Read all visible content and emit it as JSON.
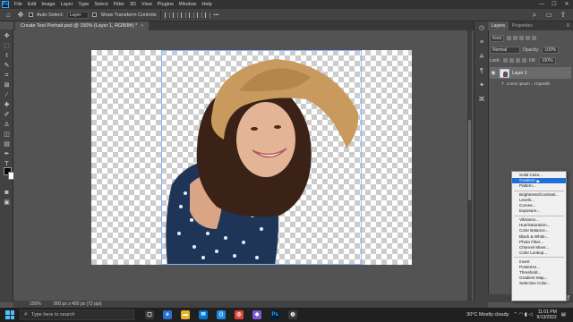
{
  "app": {
    "logo": "Ps"
  },
  "menubar": {
    "items": [
      "File",
      "Edit",
      "Image",
      "Layer",
      "Type",
      "Select",
      "Filter",
      "3D",
      "View",
      "Plugins",
      "Window",
      "Help"
    ],
    "minimize": "—",
    "maximize": "☐",
    "close": "✕"
  },
  "optbar": {
    "auto_select_label": "Auto-Select:",
    "auto_select_value": "Layer",
    "transform_label": "Show Transform Controls"
  },
  "document": {
    "tab_title": "Create Text Portrait.psd @ 150% (Layer 1, RGB/8#) *",
    "close": "×"
  },
  "status": {
    "zoom": "150%",
    "doc_info": "900 px x 400 px (72 ppi)"
  },
  "panel": {
    "tabs": [
      "Layers",
      "Properties"
    ],
    "menu_icon": "≡",
    "kind": "Kind",
    "blend_mode": "Normal",
    "opacity_label": "Opacity:",
    "opacity_value": "100%",
    "lock_label": "Lock:",
    "fill_label": "Fill:",
    "fill_value": "100%",
    "layer_name": "Layer 1",
    "sublayer_text": "Lorem ipsum ...t bpsedit"
  },
  "adjustments_menu": {
    "groups": [
      [
        "Solid Color...",
        "Gradient...",
        "Pattern..."
      ],
      [
        "Brightness/Contrast...",
        "Levels...",
        "Curves...",
        "Exposure..."
      ],
      [
        "Vibrance...",
        "Hue/Saturation...",
        "Color Balance...",
        "Black & White...",
        "Photo Filter...",
        "Channel Mixer...",
        "Color Lookup..."
      ],
      [
        "Invert",
        "Posterize...",
        "Threshold...",
        "Gradient Map...",
        "Selective Color..."
      ]
    ],
    "highlighted": "Gradient..."
  },
  "taskbar": {
    "search_placeholder": "Type here to search",
    "weather": "30°C  Mostly cloudy",
    "time": "11:01 PM",
    "date": "9/13/2022"
  },
  "colors": {
    "foreground": "#050505",
    "background": "#ffffff",
    "accent": "#1e6fd9"
  }
}
